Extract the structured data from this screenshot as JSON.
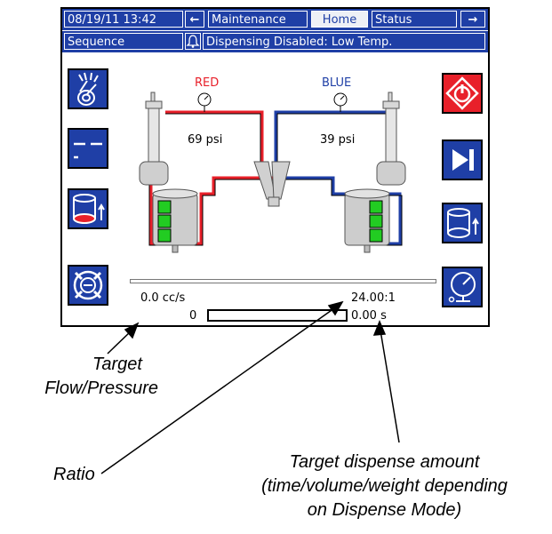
{
  "header": {
    "datetime": "08/19/11 13:42",
    "left_arrow": "←",
    "right_arrow": "→",
    "tabs": [
      {
        "label": "Maintenance",
        "selected": false
      },
      {
        "label": "Home",
        "selected": true
      },
      {
        "label": "Status",
        "selected": false
      }
    ]
  },
  "status_bar": {
    "mode": "Sequence",
    "alarm_icon": "bell-icon",
    "message": "Dispensing Disabled: Low Temp."
  },
  "diagram": {
    "red_label": "RED",
    "blue_label": "BLUE",
    "red_pressure": "69 psi",
    "blue_pressure": "39 psi",
    "red_tank_level": 1.0,
    "blue_tank_level": 1.0
  },
  "readouts": {
    "flow": "0.0 cc/s",
    "ratio": "24.00:1",
    "dispense_progress_min": "0",
    "dispense_amount": "0.00 s",
    "dispense_progress": 0
  },
  "left_buttons": [
    {
      "icon": "dispense-valve-icon"
    },
    {
      "icon": "sequence-icon"
    },
    {
      "icon": "red-reservoir-fill-icon"
    },
    {
      "icon": "pump-disable-icon"
    }
  ],
  "right_buttons": [
    {
      "icon": "stop-icon"
    },
    {
      "icon": "step-forward-icon"
    },
    {
      "icon": "blue-reservoir-fill-icon"
    },
    {
      "icon": "pressure-gauge-icon"
    }
  ],
  "annotations": {
    "target_flow_line1": "Target",
    "target_flow_line2": "Flow/Pressure",
    "ratio": "Ratio",
    "dispense_line1": "Target dispense amount",
    "dispense_line2": "(time/volume/weight depending",
    "dispense_line3": "on Dispense Mode)"
  },
  "colors": {
    "blue_primary": "#1f3fa6",
    "red_fluid": "#e8202a",
    "tank_level_green": "#22cc22"
  }
}
